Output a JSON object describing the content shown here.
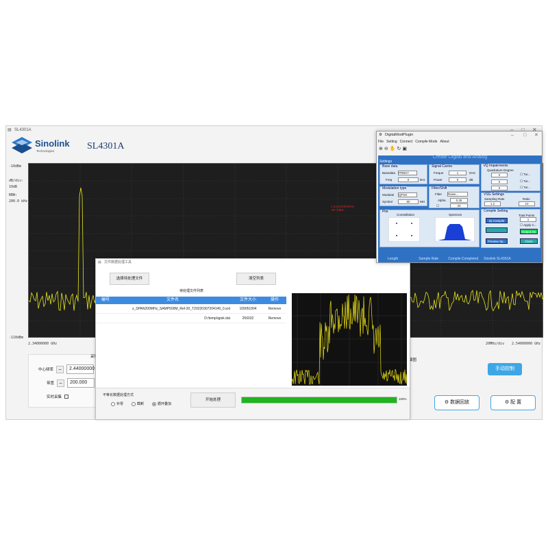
{
  "main_window": {
    "title": "SL4301A",
    "app_title": "SL4301A",
    "logo_text": "Sinolink",
    "logo_sub": "Technologies",
    "controls": {
      "min": "–",
      "max": "□",
      "close": "✕"
    }
  },
  "spectrum": {
    "ref_level": "-10dBm",
    "scale_label": "dB/div:",
    "scale_value": "10dB",
    "rbw_label": "RBW:",
    "rbw_value": "200.0 kHz",
    "bottom_level": "-110dBm",
    "start_freq": "2.34000000 GHz",
    "stop_freq": "2.54000000 GHz",
    "span_per_div": "20MHz/div",
    "marker_line1": "1 2441000000Hz",
    "marker_line2": "-66.7dBm",
    "trace_color": "#e8e820"
  },
  "control_panel": {
    "heading": "采集",
    "center_label": "中心频率",
    "center_value": "2.44000000",
    "span_label": "带宽",
    "span_value": "200.000",
    "realtime_label": "实时采集",
    "minus": "−"
  },
  "buttons": {
    "manual": "手动控制",
    "playback": "数据回放",
    "config": "配  置"
  },
  "side_label": "谱图",
  "dialog": {
    "title": "文件数据处理工具",
    "select_files": "选择待处理文件",
    "clear_list": "清空列表",
    "list_title": "待处理文件列表",
    "columns": [
      "编号",
      "文件名",
      "文件大小",
      "操作"
    ],
    "rows": [
      {
        "filename": "z_SPAN200MHz_SAMP500M_Ref-20_T20220307204149_0.srd",
        "size": "109051904",
        "action": "Remove"
      },
      {
        "filename": "D:/temp/qpsk.dat",
        "size": "256032",
        "action": "Remove"
      }
    ],
    "mode_title": "不等长数据处理方式",
    "modes": [
      "补零",
      "截断",
      "循环叠加"
    ],
    "selected_mode": 2,
    "start": "开始处理",
    "progress": 1.0,
    "progress_text": "100%"
  },
  "plugin": {
    "title": "DigitalModPlugin",
    "menu": [
      "File",
      "Setting",
      "Connect",
      "Compile Mode",
      "About"
    ],
    "header": "Create Digital and Analog",
    "settings": "Settings",
    "base_data": {
      "title": "Base data",
      "source_label": "Basedata",
      "source": "PRBS7",
      "freq_label": "Freq",
      "freq": "0",
      "freq_unit": "kHz"
    },
    "carrier": {
      "title": "Signal Carrier",
      "freq_label": "Freque",
      "freq": "1",
      "freq_unit": "GHz",
      "power_label": "Power",
      "power": "0",
      "power_unit": "dB"
    },
    "iq": {
      "title": "I/Q Impairments",
      "item": "Quadrature Degree",
      "check": "Tur..."
    },
    "modulation": {
      "title": "Modulation type",
      "mod_label": "Modulati",
      "mod": "QPSK",
      "rate_label": "Symbol",
      "rate": "80",
      "rate_unit": "MH"
    },
    "filter": {
      "title": "Filter/Shift",
      "filter_label": "Filter",
      "filter": "Raise...",
      "alpha_label": "Alpha",
      "alpha": "0.35",
      "len": "20"
    },
    "vsg": {
      "title": "VSG Settings",
      "samp_label": "Sampling Rate",
      "samp": "1.2",
      "ratio_label": "Ratio",
      "ratio": "10"
    },
    "compile": {
      "title": "Compile Setting",
      "lenlabel": "Total Points",
      "len": "1",
      "apply": "Apply C...",
      "iq_compile": "IQ Compile",
      "output": "Output On",
      "preview": "Preview Sp...",
      "close": "Close"
    },
    "plot": {
      "title": "Plot",
      "constellation": "Constellation",
      "spectrum": "Spectrum"
    },
    "status": [
      "Length",
      "Sample Rate",
      "Compile Completed",
      "Sinolink SL4301A"
    ]
  }
}
